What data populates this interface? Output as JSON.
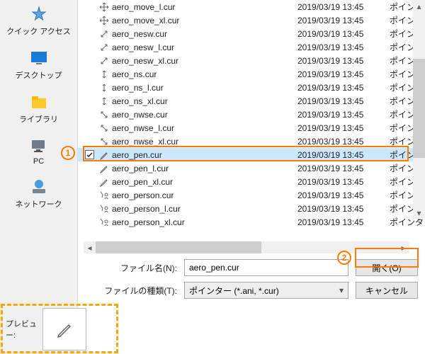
{
  "sidebar": {
    "items": [
      {
        "label": "クイック アクセス",
        "icon": "star-icon",
        "color": "#3895d3"
      },
      {
        "label": "デスクトップ",
        "icon": "desktop-icon",
        "color": "#1b7ad6"
      },
      {
        "label": "ライブラリ",
        "icon": "libraries-icon",
        "color": "#ffca28"
      },
      {
        "label": "PC",
        "icon": "pc-icon",
        "color": "#6f7c8a"
      },
      {
        "label": "ネットワーク",
        "icon": "network-icon",
        "color": "#3895d3"
      }
    ]
  },
  "files": [
    {
      "name": "aero_move_l.cur",
      "date": "2019/03/19 13:45",
      "type": "ポインタ",
      "icon": "move"
    },
    {
      "name": "aero_move_xl.cur",
      "date": "2019/03/19 13:45",
      "type": "ポインタ",
      "icon": "move"
    },
    {
      "name": "aero_nesw.cur",
      "date": "2019/03/19 13:45",
      "type": "ポインタ",
      "icon": "diag1"
    },
    {
      "name": "aero_nesw_l.cur",
      "date": "2019/03/19 13:45",
      "type": "ポインタ",
      "icon": "diag1"
    },
    {
      "name": "aero_nesw_xl.cur",
      "date": "2019/03/19 13:45",
      "type": "ポインタ",
      "icon": "diag1"
    },
    {
      "name": "aero_ns.cur",
      "date": "2019/03/19 13:45",
      "type": "ポインタ",
      "icon": "ns"
    },
    {
      "name": "aero_ns_l.cur",
      "date": "2019/03/19 13:45",
      "type": "ポインタ",
      "icon": "ns"
    },
    {
      "name": "aero_ns_xl.cur",
      "date": "2019/03/19 13:45",
      "type": "ポインタ",
      "icon": "ns"
    },
    {
      "name": "aero_nwse.cur",
      "date": "2019/03/19 13:45",
      "type": "ポインタ",
      "icon": "diag2"
    },
    {
      "name": "aero_nwse_l.cur",
      "date": "2019/03/19 13:45",
      "type": "ポインタ",
      "icon": "diag2"
    },
    {
      "name": "aero_nwse_xl.cur",
      "date": "2019/03/19 13:45",
      "type": "ポインタ",
      "icon": "diag2"
    },
    {
      "name": "aero_pen.cur",
      "date": "2019/03/19 13:45",
      "type": "ポインタ",
      "icon": "pen",
      "selected": true,
      "checked": true
    },
    {
      "name": "aero_pen_l.cur",
      "date": "2019/03/19 13:45",
      "type": "ポインタ",
      "icon": "pen"
    },
    {
      "name": "aero_pen_xl.cur",
      "date": "2019/03/19 13:45",
      "type": "ポインタ",
      "icon": "pen"
    },
    {
      "name": "aero_person.cur",
      "date": "2019/03/19 13:45",
      "type": "ポインタ",
      "icon": "person"
    },
    {
      "name": "aero_person_l.cur",
      "date": "2019/03/19 13:45",
      "type": "ポインタ",
      "icon": "person"
    },
    {
      "name": "aero_person_xl.cur",
      "date": "2019/03/19 13:45",
      "type": "ポインタ",
      "icon": "person"
    }
  ],
  "form": {
    "filename_label": "ファイル名(N):",
    "filename_value": "aero_pen.cur",
    "filetype_label": "ファイルの種類(T):",
    "filetype_value": "ポインター (*.ani, *.cur)",
    "open_label": "開く(O)",
    "cancel_label": "キャンセル"
  },
  "preview": {
    "label": "プレビュー:"
  },
  "callouts": {
    "one": "1",
    "two": "2"
  }
}
